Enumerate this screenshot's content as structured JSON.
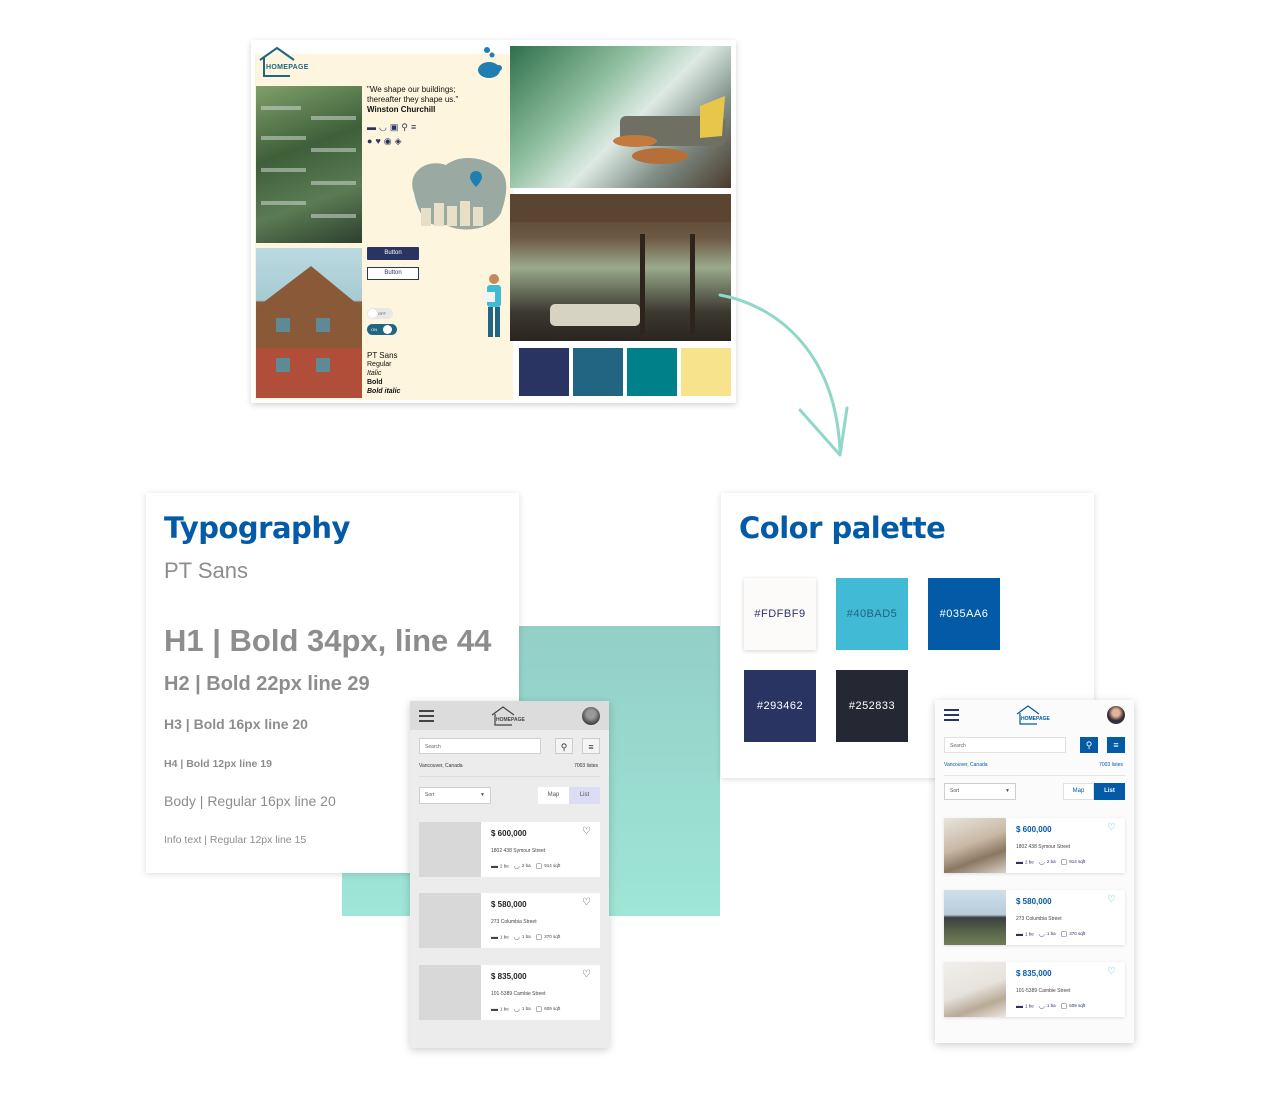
{
  "moodboard": {
    "logo": "HOMEPAGE",
    "quote_line1": "\"We shape our buildings;",
    "quote_line2": "thereafter they shape us.\"",
    "quote_author": "Winston Churchill",
    "button_filled": "Button",
    "button_outline": "Button",
    "toggle_off": "OFF",
    "toggle_on": "ON",
    "font_name": "PT Sans",
    "font_regular": "Regular",
    "font_italic": "Italic",
    "font_bold": "Bold",
    "font_bold_italic": "Bold italic",
    "swatches": [
      "#293462",
      "#216583",
      "#00818a",
      "#f7e38b"
    ]
  },
  "typography": {
    "title": "Typography",
    "font": "PT Sans",
    "h1": "H1 | Bold 34px, line 44",
    "h2": "H2 | Bold 22px line 29",
    "h3": "H3 | Bold 16px line 20",
    "h4": "H4 | Bold 12px line 19",
    "body": "Body | Regular 16px line 20",
    "info": "Info text | Regular 12px line 15"
  },
  "palette": {
    "title": "Color palette",
    "colors": [
      {
        "hex": "#FDFBF9"
      },
      {
        "hex": "#40BAD5"
      },
      {
        "hex": "#035AA6"
      },
      {
        "hex": "#293462"
      },
      {
        "hex": "#252833"
      }
    ]
  },
  "app": {
    "logo": "HOMEPAGE",
    "search_placeholder": "Search",
    "location": "Vancouver, Canada",
    "count": "7003 listes",
    "sort": "Sort",
    "map": "Map",
    "list": "List",
    "listings": [
      {
        "price": "$ 600,000",
        "address": "1802 438 Symour Street",
        "beds": "2 be",
        "baths": "2 ba",
        "area": "914 sqft"
      },
      {
        "price": "$ 580,000",
        "address": "273 Columbia Street",
        "beds": "1 be",
        "baths": "1 ba",
        "area": "370 sqft"
      },
      {
        "price": "$ 835,000",
        "address": "101-5389 Cambie Street",
        "beds": "1 be",
        "baths": "1 ba",
        "area": "609 sqft"
      }
    ]
  }
}
